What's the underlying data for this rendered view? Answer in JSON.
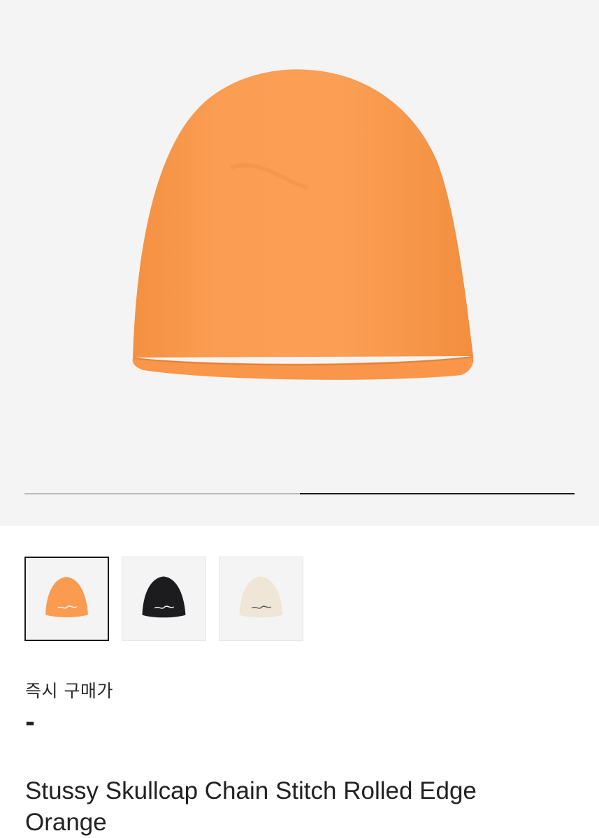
{
  "product": {
    "title": "Stussy Skullcap Chain Stitch Rolled Edge Orange",
    "color_hex": "#fa9b4f"
  },
  "gallery": {
    "image_count": 2,
    "current_image": 2
  },
  "variants": [
    {
      "icon": "beanie-orange-icon",
      "color": "#fa9b4f",
      "selected": true
    },
    {
      "icon": "beanie-black-icon",
      "color": "#1c1c1e",
      "selected": false
    },
    {
      "icon": "beanie-cream-icon",
      "color": "#efe6d8",
      "selected": false
    }
  ],
  "price": {
    "label": "즉시 구매가",
    "value": "-"
  }
}
